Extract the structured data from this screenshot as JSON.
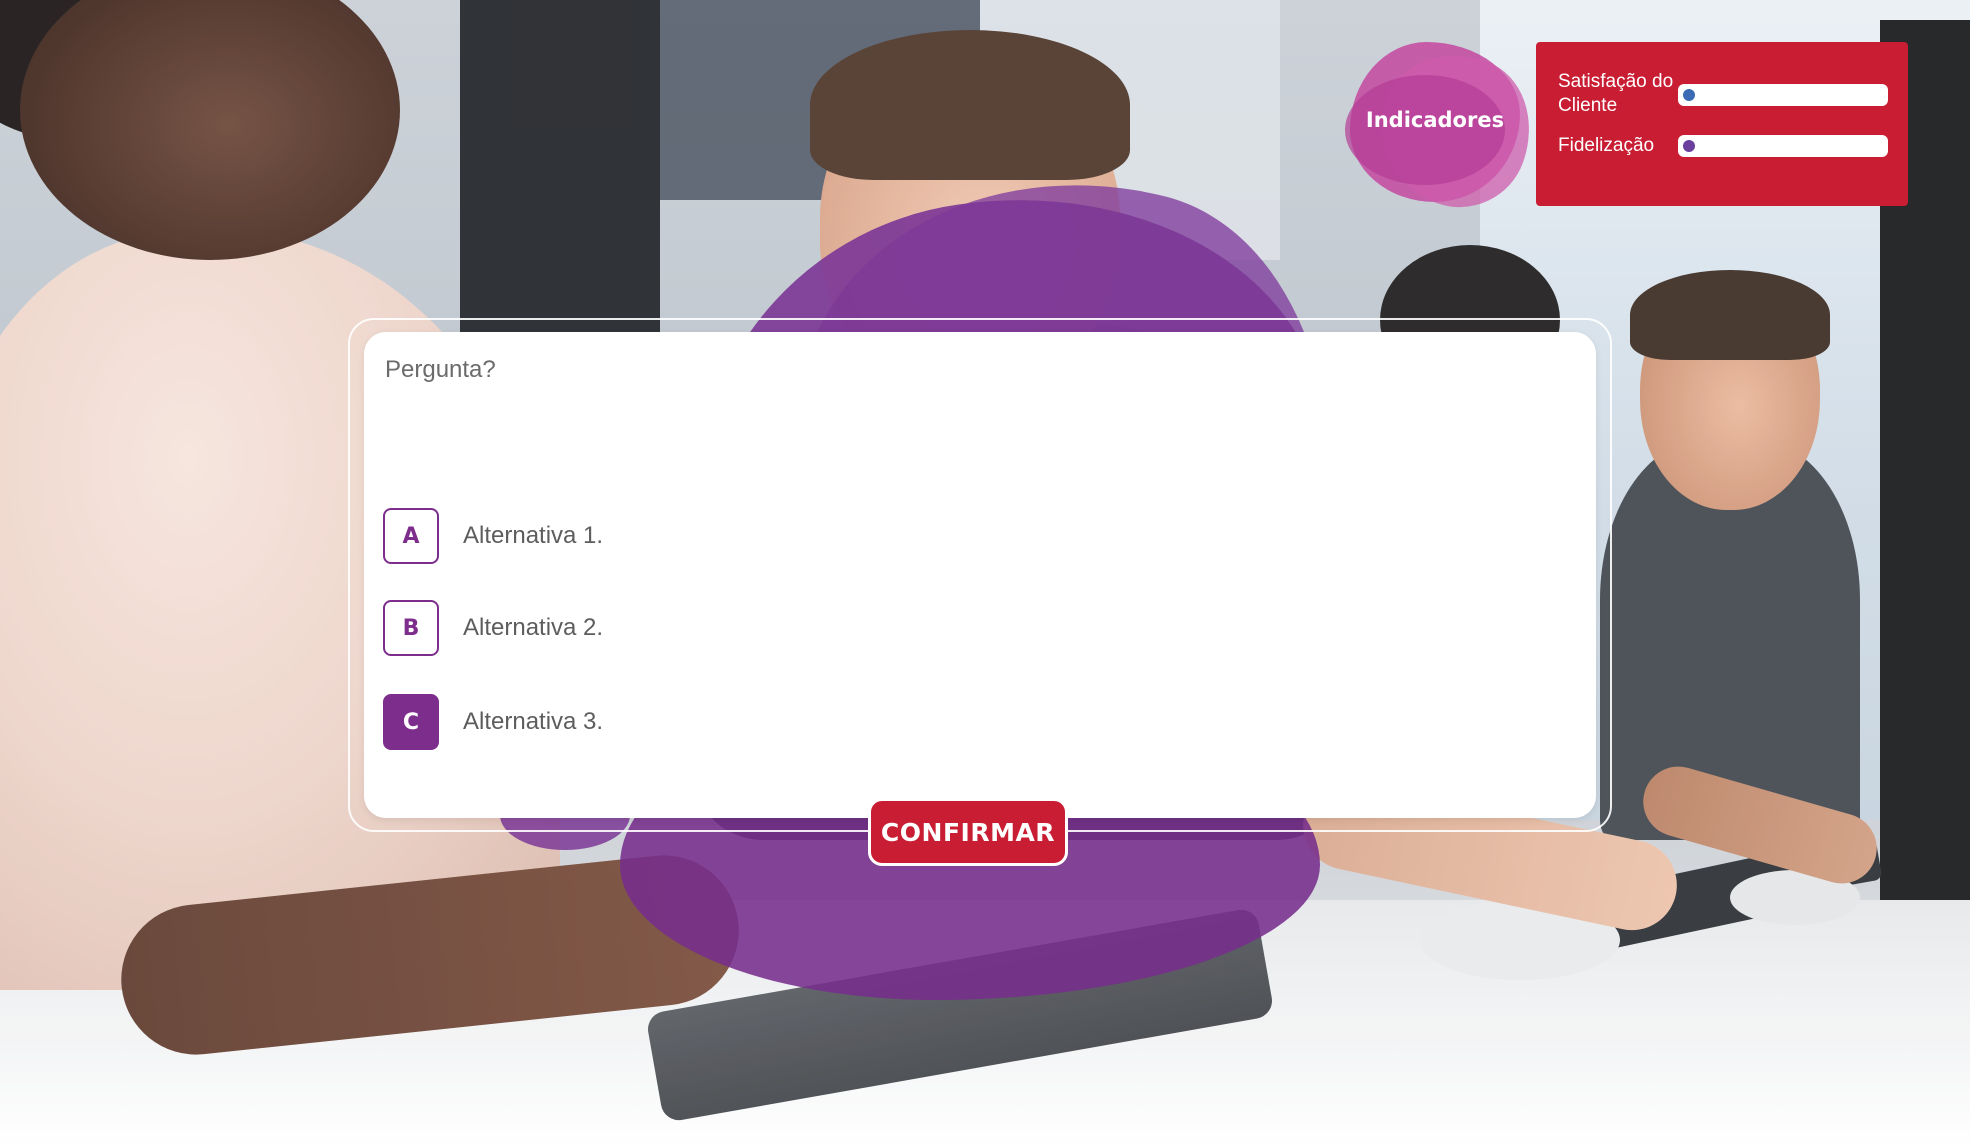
{
  "colors": {
    "accent_purple": "#7d2e8c",
    "confirm_red": "#c81d33",
    "indicator_panel": "#c81d33",
    "indicator_blob": "#c448a0",
    "satisfaction_dot": "#3b6bb5",
    "loyalty_dot": "#6b3f9e"
  },
  "question": {
    "text": "Pergunta?",
    "options": [
      {
        "letter": "A",
        "text": "Alternativa 1.",
        "selected": false
      },
      {
        "letter": "B",
        "text": "Alternativa 2.",
        "selected": false
      },
      {
        "letter": "C",
        "text": "Alternativa 3.",
        "selected": true
      }
    ]
  },
  "confirm": {
    "label": "CONFIRMAR"
  },
  "indicators": {
    "title": "Indicadores",
    "items": [
      {
        "label": "Satisfação do Cliente",
        "value": 0,
        "dot_color": "#3b6bb5"
      },
      {
        "label": "Fidelização",
        "value": 0,
        "dot_color": "#6b3f9e"
      }
    ]
  }
}
